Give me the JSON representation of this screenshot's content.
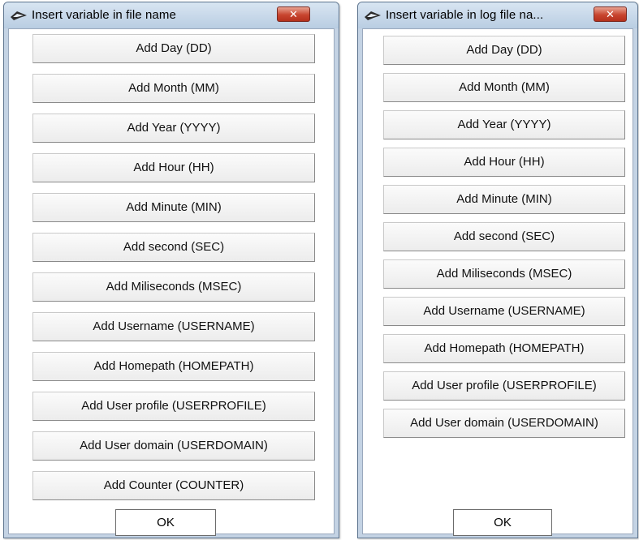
{
  "dialog1": {
    "title": "Insert variable in file name",
    "close_label": "✕",
    "buttons": [
      "Add Day (DD)",
      "Add Month (MM)",
      "Add Year (YYYY)",
      "Add Hour (HH)",
      "Add Minute (MIN)",
      "Add second (SEC)",
      "Add Miliseconds (MSEC)",
      "Add Username (USERNAME)",
      "Add Homepath (HOMEPATH)",
      "Add User profile (USERPROFILE)",
      "Add User domain (USERDOMAIN)",
      "Add Counter (COUNTER)"
    ],
    "ok_label": "OK"
  },
  "dialog2": {
    "title": "Insert variable in log file na...",
    "close_label": "✕",
    "buttons": [
      "Add Day (DD)",
      "Add Month (MM)",
      "Add Year (YYYY)",
      "Add Hour (HH)",
      "Add Minute (MIN)",
      "Add second (SEC)",
      "Add Miliseconds (MSEC)",
      "Add Username (USERNAME)",
      "Add Homepath (HOMEPATH)",
      "Add User profile (USERPROFILE)",
      "Add User domain (USERDOMAIN)"
    ],
    "ok_label": "OK"
  },
  "icons": {
    "app": "app-logo-icon",
    "close": "close-icon"
  },
  "colors": {
    "titlebar": "#c4d3e4",
    "close_button": "#c8452f",
    "client_background": "#ffffff"
  }
}
